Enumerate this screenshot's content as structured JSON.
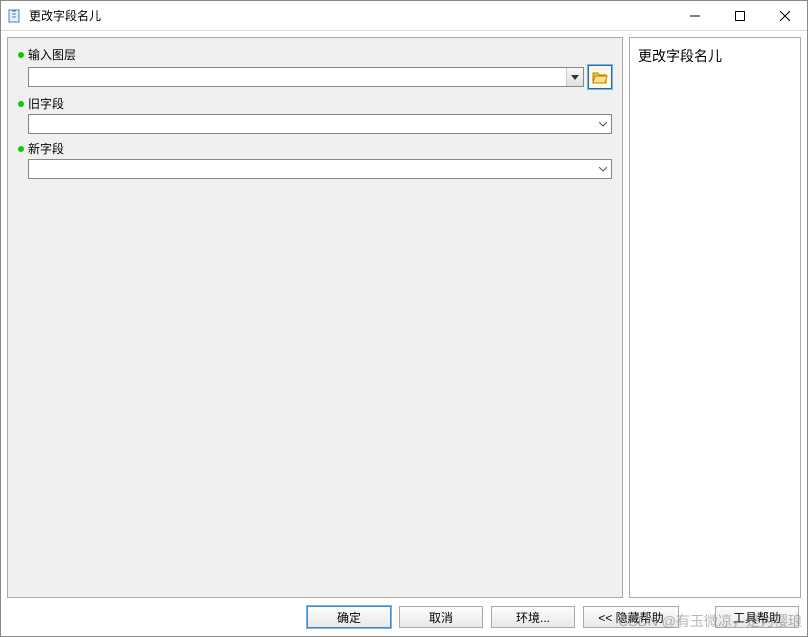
{
  "window": {
    "title": "更改字段名儿"
  },
  "form": {
    "fields": [
      {
        "label": "输入图层",
        "value": "",
        "has_browse": true
      },
      {
        "label": "旧字段",
        "value": "",
        "has_browse": false
      },
      {
        "label": "新字段",
        "value": "",
        "has_browse": false
      }
    ]
  },
  "help": {
    "title": "更改字段名儿"
  },
  "buttons": {
    "ok": "确定",
    "cancel": "取消",
    "environments": "环境...",
    "hide_help": "<< 隐藏帮助",
    "tool_help": "工具帮助"
  },
  "watermark": "CSDN @有玉微凉，是为樱琅"
}
